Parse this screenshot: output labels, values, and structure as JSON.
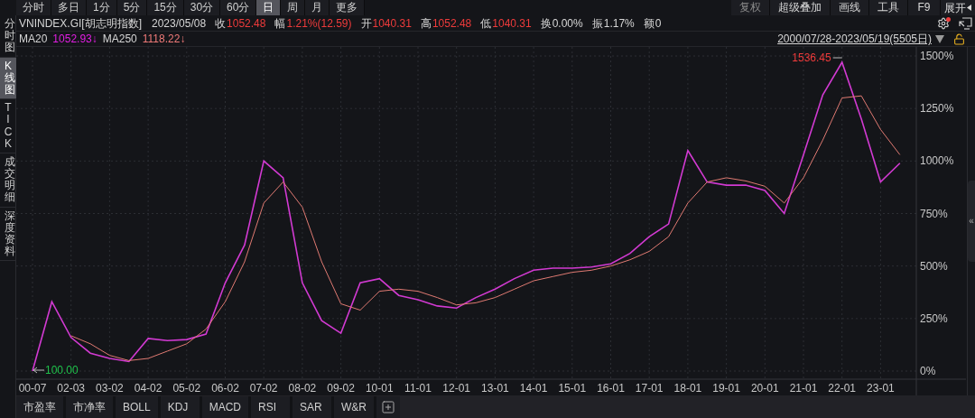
{
  "period_tabs": [
    {
      "label": "分时",
      "selected": false
    },
    {
      "label": "多日",
      "selected": false
    },
    {
      "label": "1分",
      "selected": false
    },
    {
      "label": "5分",
      "selected": false
    },
    {
      "label": "15分",
      "selected": false
    },
    {
      "label": "30分",
      "selected": false
    },
    {
      "label": "60分",
      "selected": false
    },
    {
      "label": "日",
      "selected": true
    },
    {
      "label": "周",
      "selected": false
    },
    {
      "label": "月",
      "selected": false
    },
    {
      "label": "更多",
      "selected": false
    }
  ],
  "tools": [
    {
      "label": "复权",
      "disabled": true
    },
    {
      "label": "超级叠加",
      "disabled": false
    },
    {
      "label": "画线",
      "disabled": false
    },
    {
      "label": "工具",
      "disabled": false
    },
    {
      "label": "F9",
      "disabled": false
    }
  ],
  "expand_button": {
    "label": "展开"
  },
  "side_tabs": [
    {
      "label": "分时图",
      "selected": false
    },
    {
      "label": "K线图",
      "selected": true
    },
    {
      "label": "TICK",
      "selected": false
    },
    {
      "label": "成交明细",
      "selected": false
    },
    {
      "label": "深度资料",
      "selected": false
    }
  ],
  "quote": {
    "date": "2023/05/08",
    "fields": [
      {
        "label": "收",
        "value": "1052.48",
        "color": "#ef3b3b"
      },
      {
        "label": "幅",
        "value": "1.21%(12.59)",
        "color": "#ef3b3b"
      },
      {
        "label": "开",
        "value": "1040.31",
        "color": "#ef3b3b"
      },
      {
        "label": "高",
        "value": "1052.48",
        "color": "#ef3b3b"
      },
      {
        "label": "低",
        "value": "1040.31",
        "color": "#ef3b3b"
      },
      {
        "label": "换",
        "value": "0.00%"
      },
      {
        "label": "振",
        "value": "1.17%"
      },
      {
        "label": "额",
        "value": "0"
      }
    ]
  },
  "ma": [
    {
      "label": "MA20",
      "value": "1052.93↓",
      "color": "#e21fe2"
    },
    {
      "value": "1118.22↓",
      "color": "#f07a78"
    }
  ],
  "range": "2000/07/28-2023/05/19(5505日)",
  "chart_data": {
    "type": "line",
    "ylim": [
      0,
      1500
    ],
    "grid": true,
    "categories": [
      "00-07",
      null,
      "02-03",
      null,
      "03-02",
      null,
      "04-02",
      null,
      "05-02",
      null,
      "06-02",
      null,
      "07-02",
      null,
      "08-02",
      null,
      "09-02",
      null,
      "10-01",
      null,
      "11-01",
      null,
      "12-01",
      null,
      "13-01",
      null,
      "14-01",
      null,
      "15-01",
      null,
      "16-01",
      null,
      "17-01",
      null,
      "18-01",
      null,
      "19-01",
      null,
      "20-01",
      null,
      "21-01",
      null,
      "22-01",
      null,
      "23-01",
      null
    ],
    "yticks": [
      {
        "value": 0,
        "label": "0%"
      },
      {
        "value": 250,
        "label": "250%"
      },
      {
        "value": 500,
        "label": "500%"
      },
      {
        "value": 750,
        "label": "750%"
      },
      {
        "value": 1000,
        "label": "1000%"
      },
      {
        "value": 1250,
        "label": "1250%"
      },
      {
        "value": 1500,
        "label": "1500%"
      }
    ],
    "series": [
      {
        "name": "VNINDEX.GI[胡志明指数]",
        "color": "#d23ad2",
        "values": [
          0,
          330,
          160,
          85,
          60,
          45,
          155,
          145,
          150,
          176,
          420,
          600,
          1000,
          920,
          420,
          240,
          180,
          420,
          440,
          360,
          340,
          310,
          300,
          350,
          390,
          440,
          480,
          490,
          490,
          495,
          510,
          560,
          640,
          700,
          1050,
          900,
          885,
          885,
          860,
          750,
          1030,
          1315,
          1470,
          1200,
          900,
          990
        ]
      },
      {
        "name": "MA250",
        "color": "#e07a72",
        "values": [
          null,
          null,
          168,
          130,
          75,
          50,
          60,
          95,
          130,
          200,
          330,
          520,
          800,
          900,
          780,
          520,
          320,
          290,
          380,
          390,
          380,
          350,
          315,
          325,
          350,
          390,
          430,
          450,
          470,
          480,
          500,
          530,
          570,
          640,
          800,
          900,
          920,
          905,
          880,
          800,
          920,
          1100,
          1300,
          1310,
          1150,
          1030
        ]
      }
    ],
    "annotations": [
      "1536.45",
      "100.00"
    ]
  },
  "indicator_tabs": [
    "市盈率",
    "市净率",
    "BOLL",
    "KDJ",
    "MACD",
    "RSI",
    "SAR",
    "W&R"
  ],
  "collapse_handle": "«"
}
